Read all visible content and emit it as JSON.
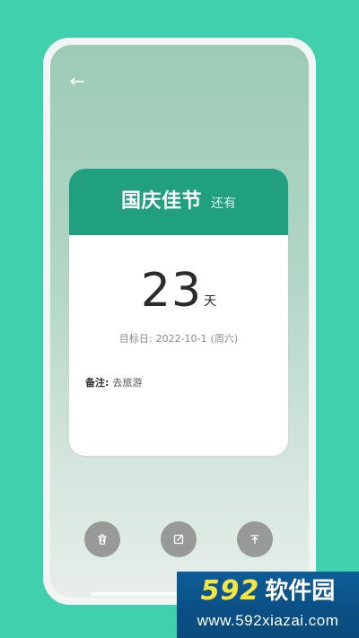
{
  "app": {
    "background_color": "#41d0ad",
    "accent_color": "#21a07f"
  },
  "header": {
    "back_icon": "arrow-left-icon"
  },
  "event_card": {
    "title": "国庆佳节",
    "title_suffix": "还有",
    "countdown_value": "23",
    "countdown_unit": "天",
    "target_label": "目标日:",
    "target_date": "2022-10-1",
    "target_weekday": "(周六)",
    "note_label": "备注:",
    "note_value": "去旅游"
  },
  "actions": {
    "delete_icon": "trash-icon",
    "edit_icon": "edit-icon",
    "pin_icon": "pin-top-icon"
  },
  "watermark": {
    "brand_number": "592",
    "brand_text": "软件园",
    "url": "www.592xiazai.com"
  }
}
